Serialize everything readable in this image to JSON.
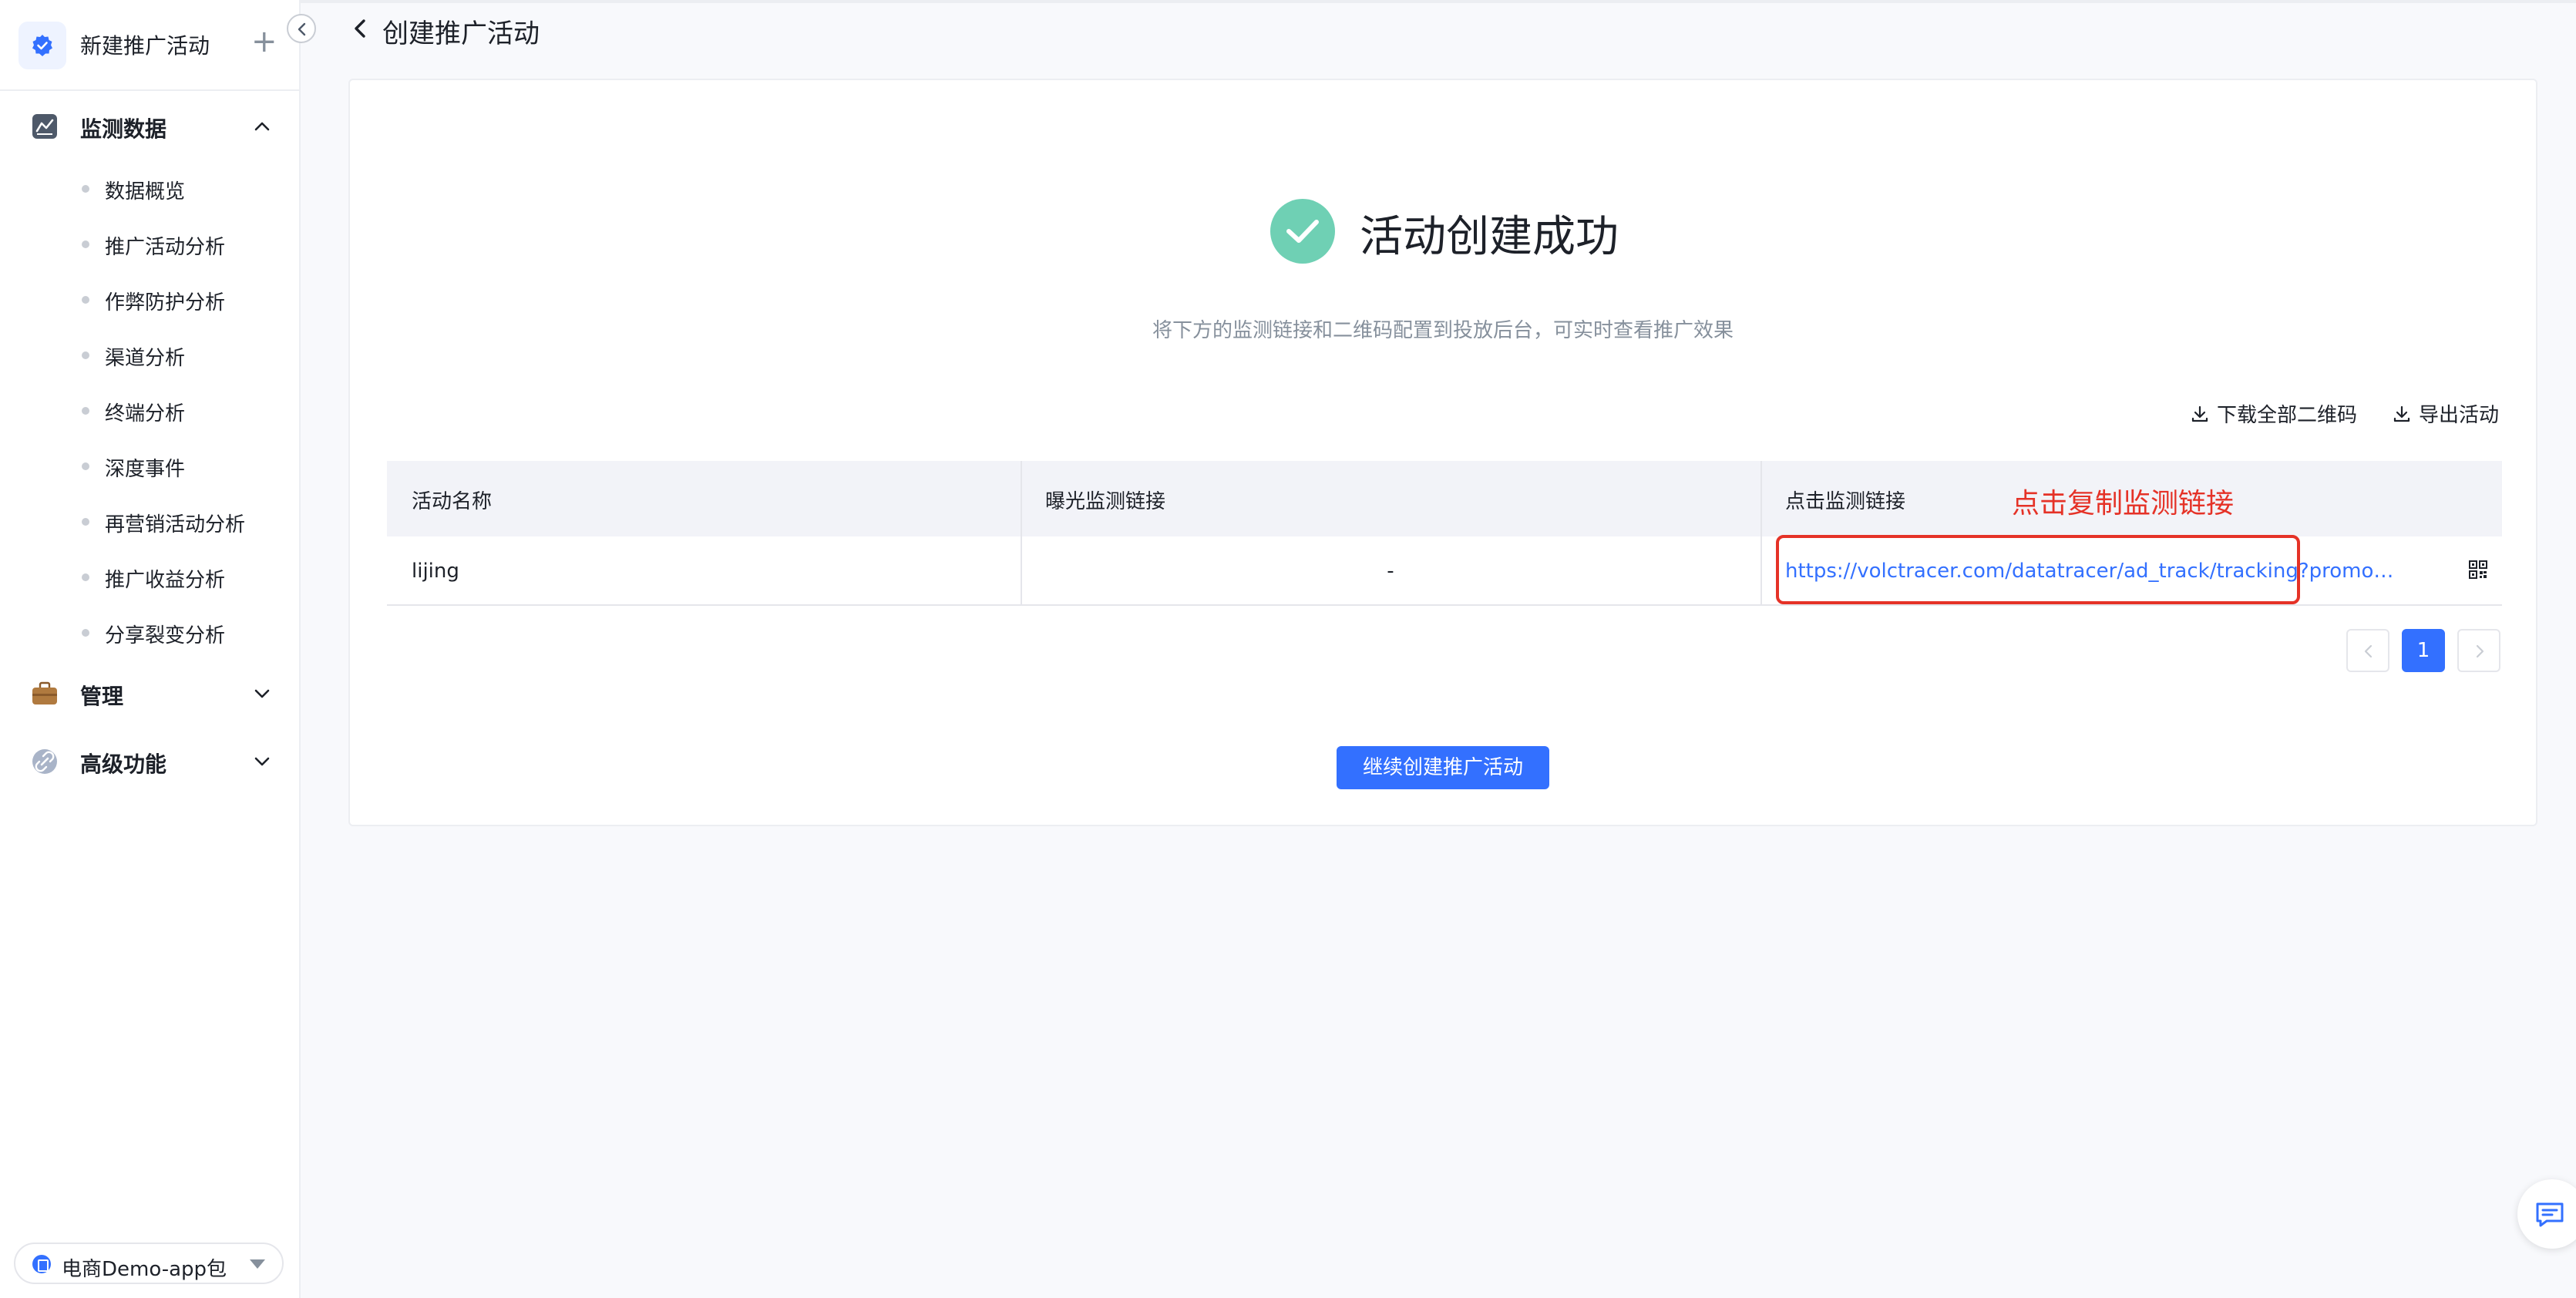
{
  "sidebar": {
    "new_activity": {
      "label": "新建推广活动",
      "plus": "+"
    },
    "groups": [
      {
        "label": "监测数据",
        "icon": "chart-icon",
        "expanded": true
      },
      {
        "label": "管理",
        "icon": "briefcase-icon",
        "expanded": false
      },
      {
        "label": "高级功能",
        "icon": "link-icon",
        "expanded": false
      }
    ],
    "items": [
      {
        "label": "数据概览"
      },
      {
        "label": "推广活动分析"
      },
      {
        "label": "作弊防护分析"
      },
      {
        "label": "渠道分析"
      },
      {
        "label": "终端分析"
      },
      {
        "label": "深度事件"
      },
      {
        "label": "再营销活动分析"
      },
      {
        "label": "推广收益分析"
      },
      {
        "label": "分享裂变分析"
      }
    ],
    "app_selector": {
      "label": "电商Demo-app包"
    }
  },
  "header": {
    "title": "创建推广活动"
  },
  "result": {
    "title": "活动创建成功",
    "subtitle": "将下方的监测链接和二维码配置到投放后台，可实时查看推广效果"
  },
  "actions": {
    "download_qr": "下载全部二维码",
    "export": "导出活动"
  },
  "table": {
    "columns": [
      "活动名称",
      "曝光监测链接",
      "点击监测链接"
    ],
    "rows": [
      {
        "name": "lijing",
        "exposure_link": "-",
        "click_link": "https://volctracer.com/datatracer/ad_track/tracking?promotion_ch..."
      }
    ]
  },
  "annotation": {
    "text": "点击复制监测链接",
    "color": "#e53227"
  },
  "pagination": {
    "current": "1"
  },
  "continue_button": "继续创建推广活动",
  "colors": {
    "primary": "#3370ff",
    "success": "#6fd0b4",
    "annotation": "#e53227"
  }
}
